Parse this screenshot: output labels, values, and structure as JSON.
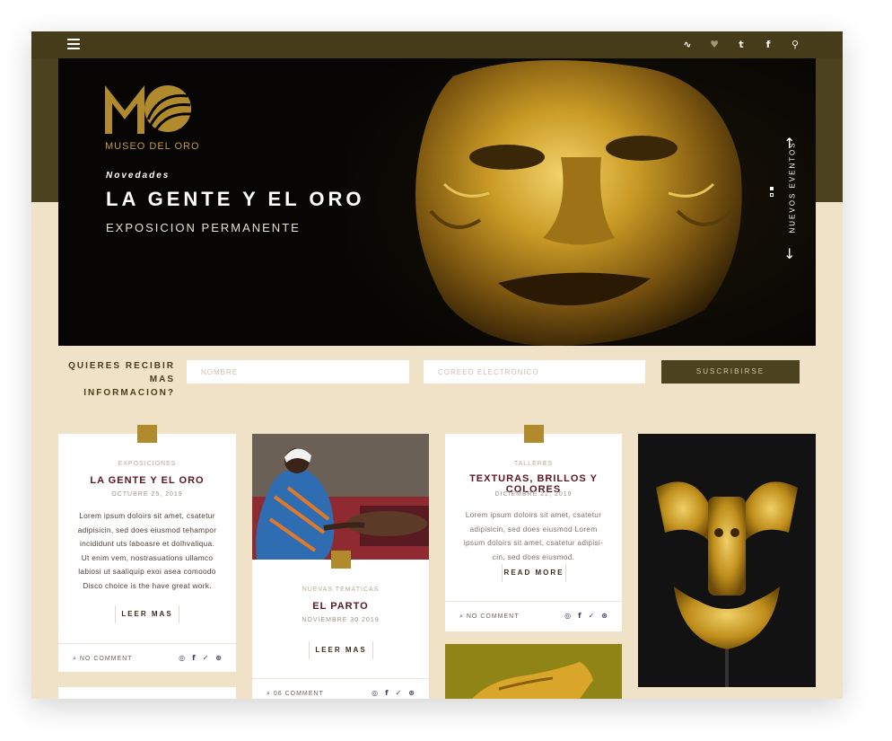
{
  "topbar": {
    "menu_icon": "hamburger-menu-icon",
    "social": [
      {
        "icon": "rss-icon",
        "glyph": "∿"
      },
      {
        "icon": "twitter-icon",
        "glyph": "♥"
      },
      {
        "icon": "tumblr-icon",
        "glyph": "t"
      },
      {
        "icon": "facebook-icon",
        "glyph": "f"
      },
      {
        "icon": "search-icon",
        "glyph": "⚲"
      }
    ]
  },
  "hero": {
    "logo_text": "MUSEO DEL ORO",
    "kicker": "Novedades",
    "title": "LA GENTE Y EL ORO",
    "subtitle": "EXPOSICION PERMANENTE",
    "side_label": "NUEVOS EVENTOS",
    "arrow_up": "↑",
    "arrow_down": "↓"
  },
  "subscribe": {
    "label_line1": "QUIERES RECIBIR",
    "label_line2": "MAS INFORMACION?",
    "name_placeholder": "NOMBRE",
    "email_placeholder": "COREEO ELECTRONICO",
    "button": "SUSCRIBIRSE"
  },
  "cards": [
    {
      "category": "EXPOSICIONES",
      "title": "LA GENTE Y EL ORO",
      "date": "OCTUBRE 25, 2019",
      "body": [
        "Lorem ipsum doloirs sit amet, csatetur",
        "adipisicin, sed does eiusmod tehampor",
        "incididunt uts laboasre et dolhvaliqua.",
        "Ut enim  vem, nostrasuations ullamco",
        "labiosi ut saaliquip exoi asea comoodo",
        "Disco choice is the have great work."
      ],
      "more": "LEER MAS",
      "comments": "NO COMMENT"
    },
    {
      "category": "NUEVAS TEMATICAS",
      "title": "EL PARTO",
      "date": "NOVIEMBRE 30 2019",
      "more": "LEER MAS",
      "comments": "06 COMMENT"
    },
    {
      "category": "TALLERES",
      "title": "TEXTURAS, BRILLOS Y COLORES",
      "date": "DICIEMBRE 22, 2019",
      "body": [
        "Lorem ipsum doloirs sit amet, csatetur",
        "adipisicin, sed does eiusmod Lorem",
        "ipsum doloirs sit amet, csatetur adipisi-",
        "cin, sed does eiusmod."
      ],
      "more": "READ MORE",
      "comments": "NO COMMENT"
    }
  ],
  "share_icons": [
    "pinterest-icon",
    "facebook-icon",
    "twitter-icon",
    "dribbble-icon"
  ],
  "colors": {
    "gold": "#b08a2c",
    "dark_olive": "#4b421e",
    "cream": "#efe2c6",
    "wine": "#5a1722"
  }
}
